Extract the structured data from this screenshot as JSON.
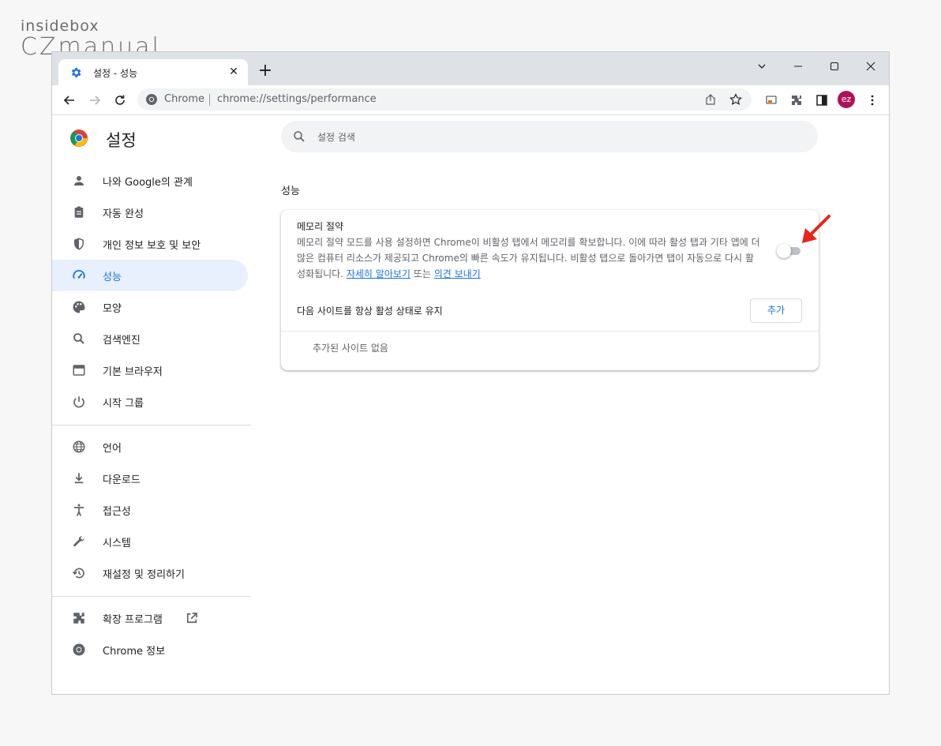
{
  "watermark": {
    "line1": "insidebox",
    "line2": "CZmanual"
  },
  "tab": {
    "title": "설정 - 성능",
    "icon": "gear-icon"
  },
  "omnibox": {
    "site": "Chrome",
    "url": "chrome://settings/performance"
  },
  "profile": {
    "initials": "ez",
    "color": "#b0125a"
  },
  "settings": {
    "title": "설정",
    "search_placeholder": "설정 검색"
  },
  "sidebar": {
    "items": [
      {
        "label": "나와 Google의 관계",
        "icon": "person-icon"
      },
      {
        "label": "자동 완성",
        "icon": "clipboard-icon"
      },
      {
        "label": "개인 정보 보호 및 보안",
        "icon": "shield-icon"
      },
      {
        "label": "성능",
        "icon": "speedometer-icon",
        "active": true
      },
      {
        "label": "모양",
        "icon": "palette-icon"
      },
      {
        "label": "검색엔진",
        "icon": "search-icon"
      },
      {
        "label": "기본 브라우저",
        "icon": "browser-icon"
      },
      {
        "label": "시작 그룹",
        "icon": "power-icon"
      },
      {
        "label": "언어",
        "icon": "globe-icon"
      },
      {
        "label": "다운로드",
        "icon": "download-icon"
      },
      {
        "label": "접근성",
        "icon": "accessibility-icon"
      },
      {
        "label": "시스템",
        "icon": "wrench-icon"
      },
      {
        "label": "재설정 및 정리하기",
        "icon": "restore-icon"
      },
      {
        "label": "확장 프로그램",
        "icon": "puzzle-icon"
      },
      {
        "label": "Chrome 정보",
        "icon": "chrome-icon"
      }
    ]
  },
  "performance": {
    "section_title": "성능",
    "memory_saver": {
      "title": "메모리 절약",
      "description": "메모리 절약 모드를 사용 설정하면 Chrome이 비활성 탭에서 메모리를 확보합니다. 이에 따라 활성 탭과 기타 앱에 더 많은 컴퓨터 리소스가 제공되고 Chrome의 빠른 속도가 유지됩니다. 비활성 탭으로 돌아가면 탭이 자동으로 다시 활성화됩니다.",
      "learn_more": "자세히 알아보기",
      "or_text": "또는",
      "feedback": "의견 보내기",
      "enabled": false
    },
    "keep_active_label": "다음 사이트를 항상 활성 상태로 유지",
    "add_button": "추가",
    "no_sites": "추가된 사이트 없음"
  },
  "colors": {
    "accent": "#1a73e8",
    "annotation_arrow": "#e8231a"
  }
}
